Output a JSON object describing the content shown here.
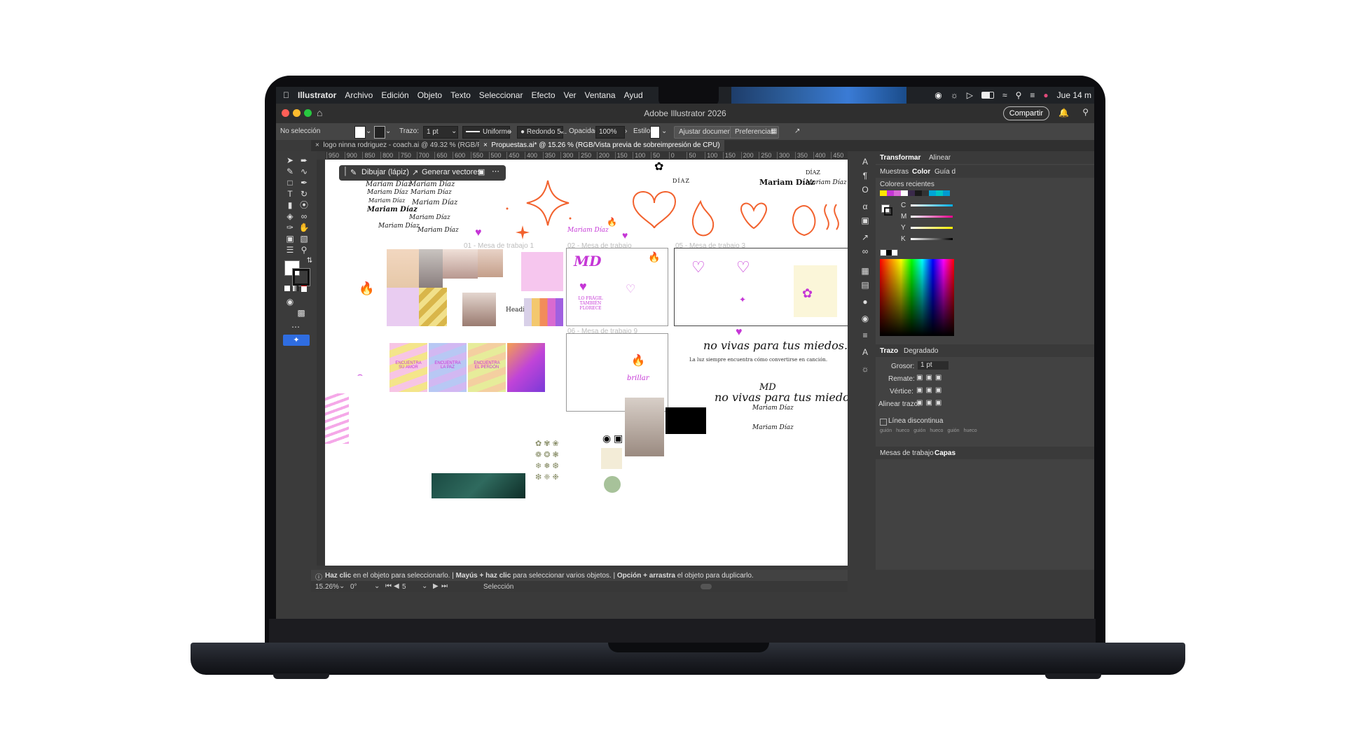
{
  "menubar": {
    "app_name": "Illustrator",
    "menus": [
      "Archivo",
      "Edición",
      "Objeto",
      "Texto",
      "Seleccionar",
      "Efecto",
      "Ver",
      "Ventana",
      "Ayud"
    ],
    "clock": "Jue 14 m"
  },
  "window": {
    "title": "Adobe Illustrator 2026",
    "share_label": "Compartir"
  },
  "controlbar": {
    "selection": "No selección",
    "stroke_label": "Trazo:",
    "stroke_value": "1 pt",
    "stroke_profile": "Uniforme",
    "brush": "Redondo 5...",
    "opacity_label": "Opacidad:",
    "opacity_value": "100%",
    "style_label": "Estilo:",
    "fit_document": "Ajustar documento",
    "preferences": "Preferencias"
  },
  "tabs": [
    {
      "label": "logo ninna rodriguez - coach.ai @ 49.32 % (RGB/Previsualizar)",
      "active": false
    },
    {
      "label": "Propuestas.ai* @ 15.26 % (RGB/Vista previa de sobreimpresión de CPU)",
      "active": true
    }
  ],
  "ruler_ticks": [
    "950",
    "900",
    "850",
    "800",
    "750",
    "700",
    "650",
    "600",
    "550",
    "500",
    "450",
    "400",
    "350",
    "300",
    "250",
    "200",
    "150",
    "100",
    "50",
    "0",
    "50",
    "100",
    "150",
    "200",
    "250",
    "300",
    "350",
    "400",
    "450"
  ],
  "float_toolbar": {
    "draw_label": "Dibujar (lápiz)",
    "vector_label": "Generar vectores"
  },
  "canvas": {
    "artboards": [
      "01 - Mesa de trabajo 1",
      "02 - Mesa de trabajo",
      "05 - Mesa de trabajo 3",
      "06 - Mesa de trabajo 9"
    ],
    "signatures": [
      "Mariam Díaz",
      "Mariam Díaz",
      "Mariam Díaz",
      "Mariam Díaz",
      "Mariam Díaz",
      "Mariam Díaz",
      "Mariam Díaz",
      "Mariam Díaz",
      "Mariam Díaz",
      "Mariam Díaz"
    ],
    "signature_bold": "Mariam Díaz",
    "diaz_label": "DÍAZ",
    "slogan": "no vivas para tus miedos.",
    "tagline": "La luz siempre encuentra cómo convertirse en canción.",
    "monogram": "MD",
    "fragil": "LO FRÁGIL TAMBIÉN FLORECE",
    "encuentra": [
      "ENCUENTRA SU AMOR",
      "ENCUENTRA LA PAZ",
      "ENCUENTRA EL PERDÓN"
    ],
    "brillar": "brillar",
    "heading": "Heading"
  },
  "right_panel": {
    "tabs_top": [
      "Transformar",
      "Alinear"
    ],
    "tabs_color": [
      "Muestras",
      "Color",
      "Guía d"
    ],
    "recent_colors_label": "Colores recientes",
    "cmyk_labels": [
      "C",
      "M",
      "Y",
      "K"
    ],
    "stroke_tabs": [
      "Trazo",
      "Degradado"
    ],
    "grosor_label": "Grosor:",
    "grosor_value": "1 pt",
    "remate_label": "Remate:",
    "vertice_label": "Vértice:",
    "alinear_label": "Alinear trazo:",
    "dashed_label": "Línea discontinua",
    "dash_labels": [
      "guión",
      "hueco",
      "guión",
      "hueco",
      "guión",
      "hueco"
    ],
    "bottom_tabs": [
      "Mesas de trabajo",
      "Capas"
    ]
  },
  "hint": {
    "part1_bold": "Haz clic",
    "part1": "en el objeto para seleccionarlo.",
    "part2_bold": "Mayús + haz clic",
    "part2": "para seleccionar varios objetos.",
    "part3_bold": "Opción + arrastra",
    "part3": "el objeto para duplicarlo."
  },
  "statusbar": {
    "zoom": "15.26%",
    "rotation": "0°",
    "artboard": "5",
    "tool": "Selección"
  },
  "colors": {
    "accent": "#2f6de1",
    "orange": "#f2622e",
    "purple": "#c536d6"
  }
}
